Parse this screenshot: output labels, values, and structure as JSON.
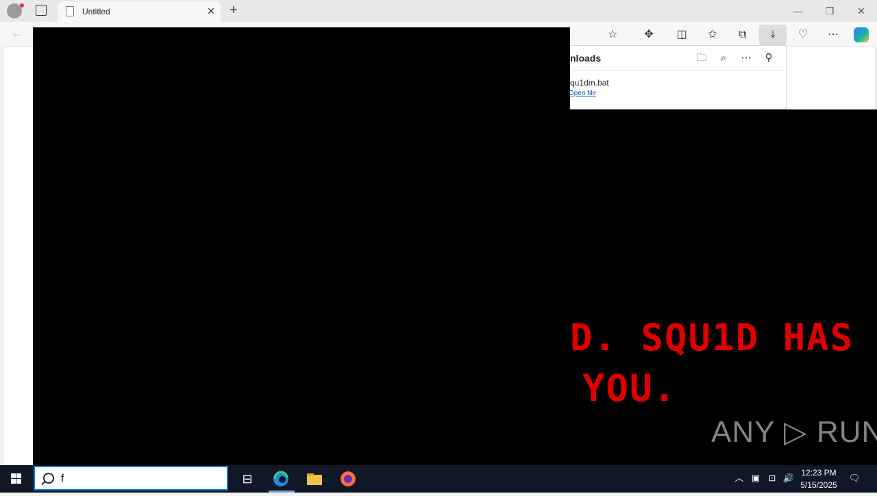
{
  "browser": {
    "tab_title": "Untitled",
    "tab_close": "✕",
    "new_tab": "+",
    "window_controls": {
      "minimize": "—",
      "restore": "❐",
      "close": "✕"
    },
    "toolbar_icons": [
      "favorites-star-icon",
      "extensions-icon",
      "split-screen-icon",
      "favorites-icon",
      "collections-icon",
      "downloads-icon",
      "browser-essentials-icon",
      "more-icon",
      "copilot-icon"
    ]
  },
  "downloads_panel": {
    "title_visible": "nloads",
    "filename_visible": "qu1dm.bat",
    "open_link_visible": "Open file"
  },
  "malware_screen": {
    "line1": "D. SQU1D HAS",
    "line2": "YOU.",
    "text_color": "#e00000"
  },
  "watermark": {
    "text": "ANY ▷ RUN"
  },
  "taskbar": {
    "search_value": "f",
    "clock_time": "12:23 PM",
    "clock_date": "5/15/2025",
    "accent": "#0078d4"
  }
}
